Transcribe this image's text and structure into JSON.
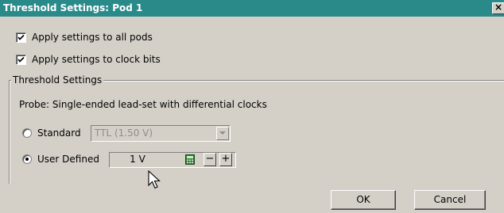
{
  "window": {
    "title": "Threshold Settings: Pod 1",
    "close_glyph": "×"
  },
  "options": {
    "apply_all_pods": {
      "label": "Apply settings to all pods",
      "checked": true
    },
    "apply_clock_bits": {
      "label": "Apply settings to clock bits",
      "checked": true
    }
  },
  "threshold_group": {
    "legend": "Threshold Settings",
    "probe_text": "Probe: Single-ended lead-set with differential clocks",
    "standard": {
      "label": "Standard",
      "selected": false,
      "combo_value": "TTL (1.50 V)"
    },
    "user_defined": {
      "label": "User Defined",
      "selected": true,
      "value": "1 V",
      "minus_label": "−",
      "plus_label": "+"
    }
  },
  "buttons": {
    "ok": "OK",
    "cancel": "Cancel"
  },
  "colors": {
    "title_bar": "#2a8a8a",
    "dialog_bg": "#d4d0c8",
    "disabled_text": "#8e8e8e"
  },
  "icons": {
    "close": "close-icon",
    "checkmark": "checkmark-icon",
    "dropdown": "chevron-down-icon",
    "calculator": "calculator-icon",
    "cursor": "mouse-pointer-icon"
  }
}
